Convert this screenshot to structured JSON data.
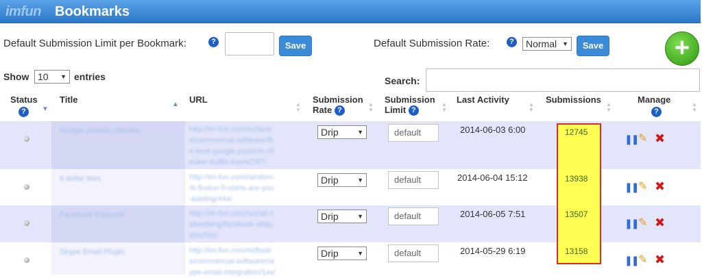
{
  "header": {
    "brand": "imfun",
    "title": "Bookmarks"
  },
  "controls": {
    "default_limit_label": "Default Submission Limit per Bookmark:",
    "default_limit_value": "",
    "save_label": "Save",
    "default_rate_label": "Default Submission Rate:",
    "default_rate_value": "Normal",
    "add_label": "+"
  },
  "table_controls": {
    "show_label": "Show",
    "entries_value": "10",
    "entries_label": "entries",
    "search_label": "Search:",
    "search_value": ""
  },
  "columns": {
    "status": "Status",
    "title": "Title",
    "url": "URL",
    "submission_rate": [
      "Submission",
      "Rate"
    ],
    "submission_limit": [
      "Submission",
      "Limit"
    ],
    "last_activity": "Last Activity",
    "submissions": "Submissions",
    "manage": "Manage"
  },
  "rows": [
    {
      "title": "Google position checker",
      "url": [
        "http://im-fun.com/softwar",
        "e/commercial-software/th",
        "e-best-google-position-ch",
        "ecker-traffic-travis/787/"
      ],
      "rate": "Drip",
      "limit": "default",
      "last_activity": "2014-06-03 6:00",
      "submissions": "12745"
    },
    {
      "title": "6 dollar tees",
      "url": [
        "http://im-fun.com/random-",
        "/6-findun-5-shirts-are-you",
        "-kidding/444/"
      ],
      "rate": "Drip",
      "limit": "default",
      "last_activity": "2014-06-04 15:12",
      "submissions": "13938"
    },
    {
      "title": "Facebook Etiquette",
      "url": [
        "http://im-fun.com/social-n",
        "etworking/facebook-etiqu",
        "ette/591/"
      ],
      "rate": "Drip",
      "limit": "default",
      "last_activity": "2014-06-05 7:51",
      "submissions": "13507"
    },
    {
      "title": "Skype Email Plugin",
      "url": [
        "http://im-fun.com/softwar",
        "e/commercial-software/sk",
        "ype-email-integration/1xx/"
      ],
      "rate": "Drip",
      "limit": "default",
      "last_activity": "2014-05-29 6:19",
      "submissions": "13158"
    }
  ],
  "icons": {
    "help": "?",
    "pause": "❚❚",
    "edit": "✎",
    "delete": "✖",
    "dropdown": "▼",
    "sort_asc": "▲",
    "sort_desc": "▼"
  }
}
